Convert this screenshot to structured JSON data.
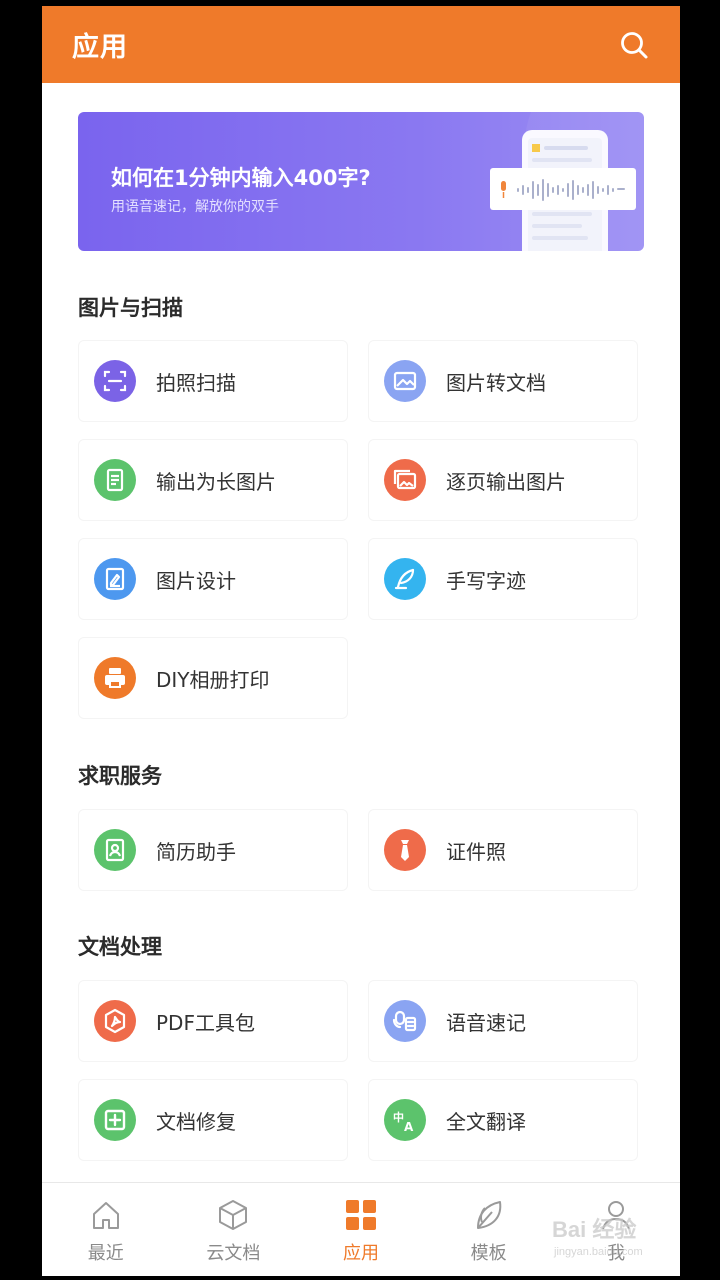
{
  "header": {
    "title": "应用",
    "search_icon": "search-icon"
  },
  "banner": {
    "title": "如何在1分钟内输入400字?",
    "subtitle": "用语音速记，解放你的双手"
  },
  "sections": [
    {
      "title": "图片与扫描",
      "items": [
        {
          "label": "拍照扫描",
          "icon": "scan-icon",
          "color": "#7b63e6"
        },
        {
          "label": "图片转文档",
          "icon": "image-icon",
          "color": "#8aa4f2"
        },
        {
          "label": "输出为长图片",
          "icon": "long-image-icon",
          "color": "#5cc36c"
        },
        {
          "label": "逐页输出图片",
          "icon": "page-images-icon",
          "color": "#ef6b4a"
        },
        {
          "label": "图片设计",
          "icon": "image-design-icon",
          "color": "#4d98ef"
        },
        {
          "label": "手写字迹",
          "icon": "handwriting-icon",
          "color": "#34b4ef"
        },
        {
          "label": "DIY相册打印",
          "icon": "print-icon",
          "color": "#ef7a2a"
        }
      ]
    },
    {
      "title": "求职服务",
      "items": [
        {
          "label": "简历助手",
          "icon": "resume-icon",
          "color": "#5cc36c"
        },
        {
          "label": "证件照",
          "icon": "id-photo-icon",
          "color": "#ef6b4a"
        }
      ]
    },
    {
      "title": "文档处理",
      "items": [
        {
          "label": "PDF工具包",
          "icon": "pdf-icon",
          "color": "#ef6b4a"
        },
        {
          "label": "语音速记",
          "icon": "voice-note-icon",
          "color": "#8aa4f2"
        },
        {
          "label": "文档修复",
          "icon": "repair-icon",
          "color": "#5cc36c"
        },
        {
          "label": "全文翻译",
          "icon": "translate-icon",
          "color": "#5cc36c"
        }
      ]
    }
  ],
  "tabbar": [
    {
      "label": "最近",
      "icon": "home-icon",
      "active": false
    },
    {
      "label": "云文档",
      "icon": "cube-icon",
      "active": false
    },
    {
      "label": "应用",
      "icon": "apps-grid-icon",
      "active": true
    },
    {
      "label": "模板",
      "icon": "leaf-icon",
      "active": false
    },
    {
      "label": "我",
      "icon": "user-icon",
      "active": false
    }
  ],
  "watermark": {
    "text": "Bai 经验",
    "sub": "jingyan.baidu.com"
  },
  "colors": {
    "accent": "#ef7a2a",
    "banner": "#7a64ee"
  }
}
